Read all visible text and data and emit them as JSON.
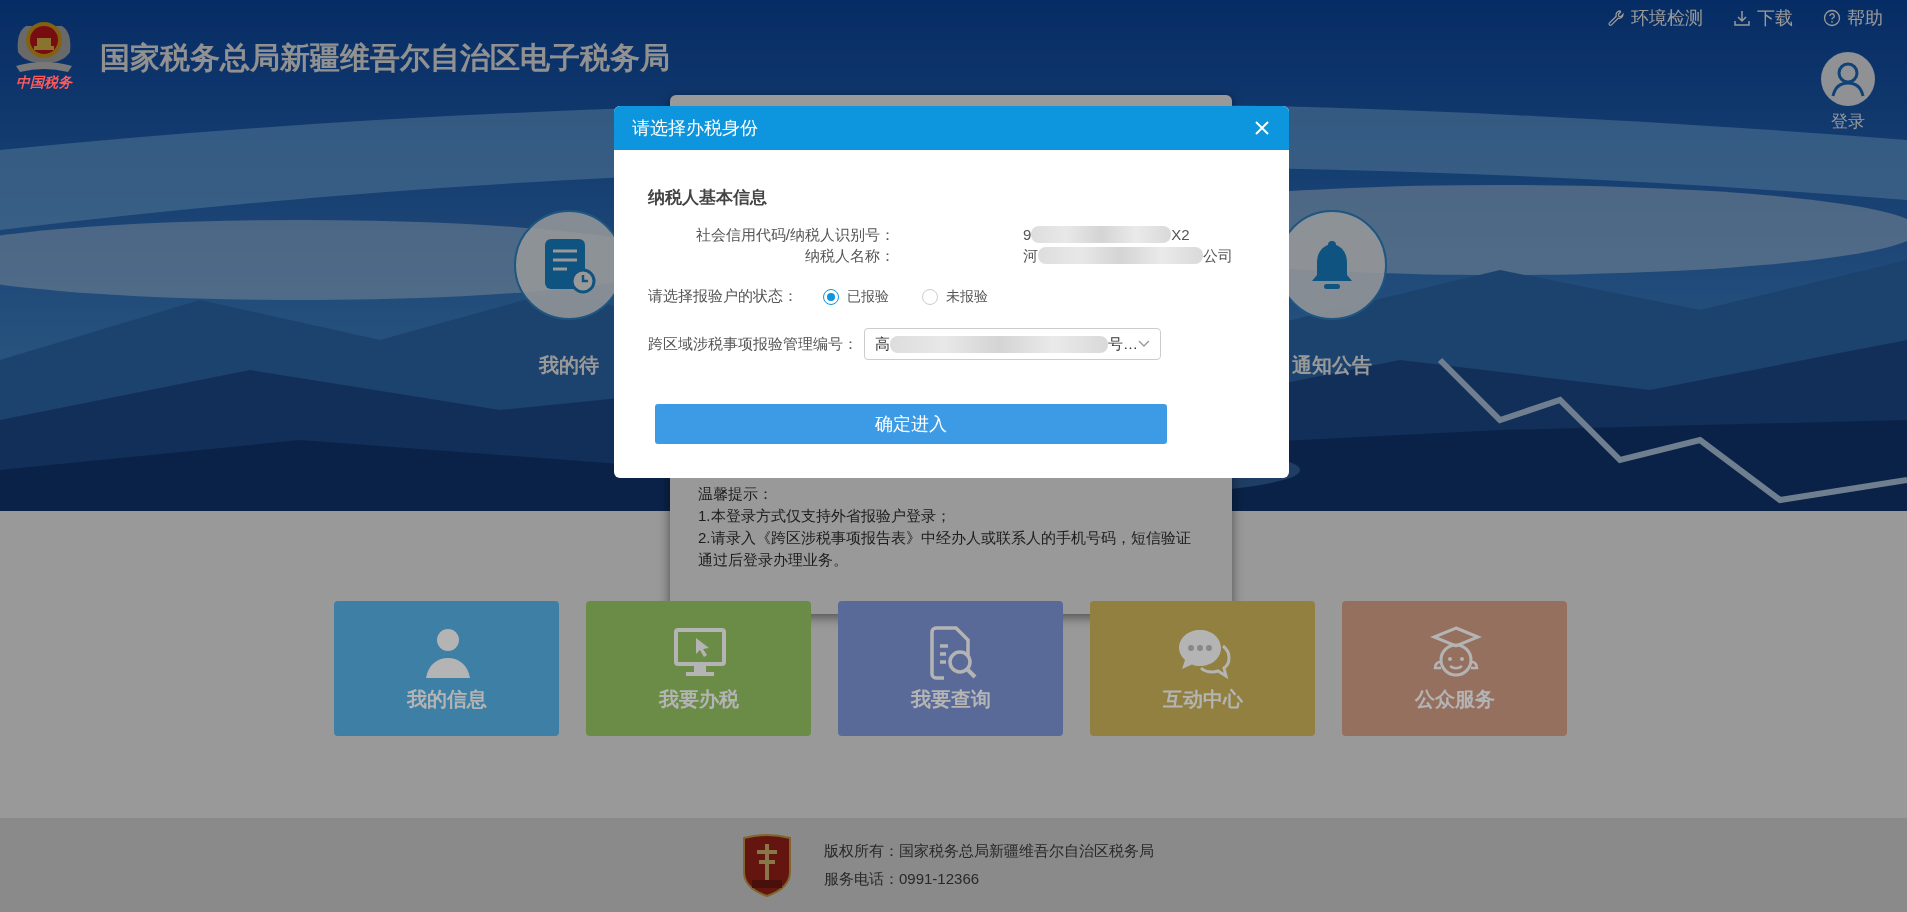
{
  "header": {
    "logo_caption": "中国税务",
    "title": "国家税务总局新疆维吾尔自治区电子税务局",
    "links": [
      {
        "label": "环境检测",
        "kind": "wrench"
      },
      {
        "label": "下载",
        "kind": "download"
      },
      {
        "label": "帮助",
        "kind": "help"
      }
    ],
    "login": "登录"
  },
  "quick_entries": [
    {
      "label": "我的待",
      "kind": "todo"
    },
    {
      "label": "通知公告",
      "kind": "bell"
    }
  ],
  "notice": {
    "lines": [
      "温馨提示：",
      "1.本登录方式仅支持外省报验户登录；",
      "2.请录入《跨区涉税事项报告表》中经办人或联系人的手机号码，短信验证通过后登录办理业务。"
    ]
  },
  "tiles": [
    {
      "label": "我的信息",
      "kind": "person",
      "color": "#3e7fa6"
    },
    {
      "label": "我要办税",
      "kind": "monitor",
      "color": "#6a8c47"
    },
    {
      "label": "我要查询",
      "kind": "search-doc",
      "color": "#5a6a98"
    },
    {
      "label": "互动中心",
      "kind": "chat",
      "color": "#918040"
    },
    {
      "label": "公众服务",
      "kind": "service",
      "color": "#96705f"
    }
  ],
  "footer": {
    "copyright": "版权所有：国家税务总局新疆维吾尔自治区税务局",
    "phone": "服务电话：0991-12366"
  },
  "dialog": {
    "title": "请选择办税身份",
    "section_title": "纳税人基本信息",
    "info": [
      {
        "label": "社会信用代码/纳税人识别号：",
        "value_start": "9",
        "value_end": "X2"
      },
      {
        "label": "纳税人名称：",
        "value_start": "河",
        "value_end": "公司"
      }
    ],
    "status": {
      "label": "请选择报验户的状态：",
      "options": [
        {
          "label": "已报验",
          "selected": true
        },
        {
          "label": "未报验",
          "selected": false
        }
      ]
    },
    "select": {
      "label": "跨区域涉税事项报验管理编号：",
      "value_start": "高",
      "value_end": "号…"
    },
    "confirm": "确定进入"
  }
}
